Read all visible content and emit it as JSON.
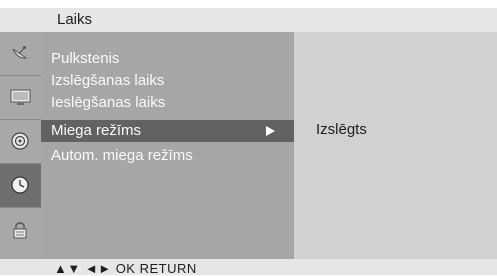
{
  "header": {
    "title": "Laiks"
  },
  "sidebar": {
    "icons": [
      {
        "name": "satellite-dish-icon",
        "active": false
      },
      {
        "name": "tv-screen-icon",
        "active": false
      },
      {
        "name": "speaker-icon",
        "active": false
      },
      {
        "name": "clock-icon",
        "active": true
      },
      {
        "name": "lock-icon",
        "active": false
      }
    ]
  },
  "menu": {
    "items": [
      {
        "label": "Pulkstenis"
      },
      {
        "label": "Izslēgšanas laiks"
      },
      {
        "label": "Ieslēgšanas laiks"
      },
      {
        "label": "Miega režīms",
        "selected": true,
        "arrow": "►"
      },
      {
        "label": "Autom. miega režīms"
      }
    ]
  },
  "value_panel": {
    "current_value": "Izslēgts"
  },
  "footer": {
    "nav_hint": "▲▼ ◄► OK RETURN"
  }
}
